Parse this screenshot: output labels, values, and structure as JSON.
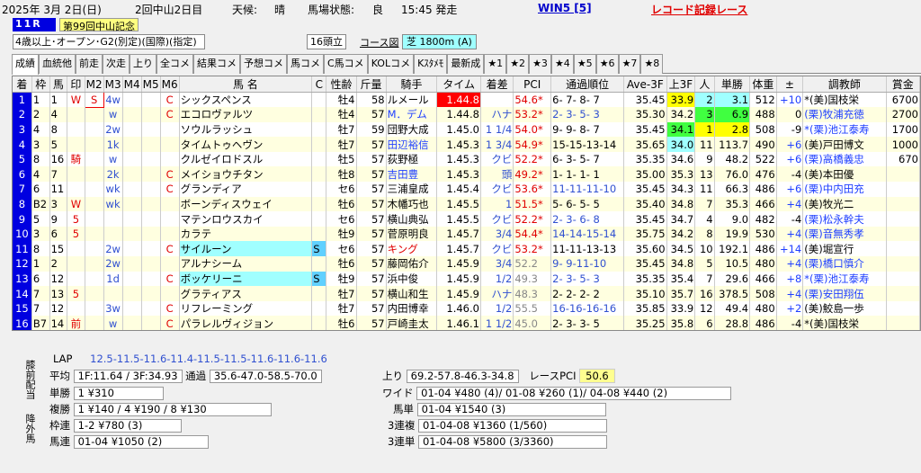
{
  "header": {
    "date": "2025年  3月  2日(日)",
    "meeting": "2回中山2日目",
    "weather_label": "天候:",
    "weather": "晴",
    "track_label": "馬場状態:",
    "track": "良",
    "time": "15:45 発走",
    "win5": "WIN5 [5]",
    "record": "レコード記録レース"
  },
  "race": {
    "num": "11R",
    "name": "第99回中山記念",
    "condition": "4歳以上･オープン･G2(別定)(国際)(指定)",
    "heads": "16頭立",
    "course_label": "コース図",
    "course": "芝 1800m (A)"
  },
  "tabs": [
    "成績",
    "血統他",
    "前走",
    "次走",
    "上り",
    "全コメ",
    "結果コメ",
    "予想コメ",
    "馬コメ",
    "C馬コメ",
    "KOLコメ",
    "Kｽﾀﾒﾓ",
    "最新成",
    "★1",
    "★2",
    "★3",
    "★4",
    "★5",
    "★6",
    "★7",
    "★8"
  ],
  "columns": [
    "着",
    "枠",
    "馬",
    "印",
    "M2",
    "M3",
    "M4",
    "M5",
    "M6",
    "馬 名",
    "C",
    "性齢",
    "斤量",
    "騎手",
    "タイム",
    "着差",
    "PCI",
    "通過順位",
    "Ave-3F",
    "上3F",
    "人",
    "単勝",
    "体重",
    "±",
    "調教師",
    "賞金"
  ],
  "rows": [
    [
      "1",
      "1",
      "1",
      "W",
      "S",
      "4w",
      "",
      "",
      "C",
      "シックスペンス",
      "",
      "牡4",
      "58",
      "ルメール",
      "1.44.8",
      "",
      "54.6*",
      "6- 7- 8- 7",
      "35.45",
      "33.9",
      "2",
      "3.1",
      "512",
      "+10",
      "*(美)国枝栄",
      "6700"
    ],
    [
      "2",
      "2",
      "4",
      "",
      "",
      "w",
      "",
      "",
      "C",
      "エコロヴァルツ",
      "",
      "牡4",
      "57",
      "M．デム",
      "1.44.8",
      "ハナ",
      "53.2*",
      "2- 3- 5- 3",
      "35.30",
      "34.2",
      "3",
      "6.9",
      "488",
      "0",
      "(栗)牧浦充徳",
      "2700"
    ],
    [
      "3",
      "4",
      "8",
      "",
      "",
      "2w",
      "",
      "",
      "",
      "ソウルラッシュ",
      "",
      "牡7",
      "59",
      "団野大成",
      "1.45.0",
      "1 1/4",
      "54.0*",
      "9- 9- 8- 7",
      "35.45",
      "34.1",
      "1",
      "2.8",
      "508",
      "-9",
      "*(栗)池江泰寿",
      "1700"
    ],
    [
      "4",
      "3",
      "5",
      "",
      "",
      "1k",
      "",
      "",
      "",
      "タイムトゥヘヴン",
      "",
      "牡7",
      "57",
      "田辺裕信",
      "1.45.3",
      "1 3/4",
      "54.9*",
      "15-15-13-14",
      "35.65",
      "34.0",
      "11",
      "113.7",
      "490",
      "+6",
      "(美)戸田博文",
      "1000"
    ],
    [
      "5",
      "8",
      "16",
      "騎",
      "",
      "w",
      "",
      "",
      "",
      "クルゼイロドスル",
      "",
      "牡5",
      "57",
      "荻野極",
      "1.45.3",
      "クビ",
      "52.2*",
      "6- 3- 5- 7",
      "35.35",
      "34.6",
      "9",
      "48.2",
      "522",
      "+6",
      "(栗)高橋義忠",
      "670"
    ],
    [
      "6",
      "4",
      "7",
      "",
      "",
      "2k",
      "",
      "",
      "C",
      "メイショウチタン",
      "",
      "牡8",
      "57",
      "吉田豊",
      "1.45.3",
      "頭",
      "49.2*",
      "1- 1- 1- 1",
      "35.00",
      "35.3",
      "13",
      "76.0",
      "476",
      "-4",
      "(美)本田優",
      ""
    ],
    [
      "7",
      "6",
      "11",
      "",
      "",
      "wk",
      "",
      "",
      "C",
      "グランディア",
      "",
      "セ6",
      "57",
      "三浦皇成",
      "1.45.4",
      "クビ",
      "53.6*",
      "11-11-11-10",
      "35.45",
      "34.3",
      "11",
      "66.3",
      "486",
      "+6",
      "(栗)中内田充",
      ""
    ],
    [
      "8",
      "B2",
      "3",
      "W",
      "",
      "wk",
      "",
      "",
      "",
      "ボーンディスウェイ",
      "",
      "牡6",
      "57",
      "木幡巧也",
      "1.45.5",
      "1",
      "51.5*",
      "5- 6- 5- 5",
      "35.40",
      "34.8",
      "7",
      "35.3",
      "466",
      "+4",
      "(美)牧光二",
      ""
    ],
    [
      "9",
      "5",
      "9",
      "5",
      "",
      "",
      "",
      "",
      "",
      "マテンロウスカイ",
      "",
      "セ6",
      "57",
      "横山典弘",
      "1.45.5",
      "クビ",
      "52.2*",
      "2- 3- 6- 8",
      "35.45",
      "34.7",
      "4",
      "9.0",
      "482",
      "-4",
      "(栗)松永幹夫",
      ""
    ],
    [
      "10",
      "3",
      "6",
      "5",
      "",
      "",
      "",
      "",
      "",
      "カラテ",
      "",
      "牡9",
      "57",
      "菅原明良",
      "1.45.7",
      "3/4",
      "54.4*",
      "14-14-15-14",
      "35.75",
      "34.2",
      "8",
      "19.9",
      "530",
      "+4",
      "(栗)音無秀孝",
      ""
    ],
    [
      "11",
      "8",
      "15",
      "",
      "",
      "2w",
      "",
      "",
      "C",
      "サイルーン",
      "S",
      "セ6",
      "57",
      "キング",
      "1.45.7",
      "クビ",
      "53.2*",
      "11-11-13-13",
      "35.60",
      "34.5",
      "10",
      "192.1",
      "486",
      "+14",
      "(美)堀宣行",
      ""
    ],
    [
      "12",
      "1",
      "2",
      "",
      "",
      "2w",
      "",
      "",
      "",
      "アルナシーム",
      "",
      "牡6",
      "57",
      "藤岡佑介",
      "1.45.9",
      "3/4",
      "52.2",
      "9- 9-11-10",
      "35.45",
      "34.8",
      "5",
      "10.5",
      "480",
      "+4",
      "(栗)橋口慎介",
      ""
    ],
    [
      "13",
      "6",
      "12",
      "",
      "",
      "1d",
      "",
      "",
      "C",
      "ボッケリーニ",
      "S",
      "牡9",
      "57",
      "浜中俊",
      "1.45.9",
      "1/2",
      "49.3",
      "2- 3- 5- 3",
      "35.35",
      "35.4",
      "7",
      "29.6",
      "466",
      "+8",
      "*(栗)池江泰寿",
      ""
    ],
    [
      "14",
      "7",
      "13",
      "5",
      "",
      "",
      "",
      "",
      "",
      "グラティアス",
      "",
      "牡7",
      "57",
      "横山和生",
      "1.45.9",
      "ハナ",
      "48.3",
      "2- 2- 2- 2",
      "35.10",
      "35.7",
      "16",
      "378.5",
      "508",
      "+4",
      "(栗)安田翔伍",
      ""
    ],
    [
      "15",
      "7",
      "12",
      "",
      "",
      "3w",
      "",
      "",
      "C",
      "リフレーミング",
      "",
      "牡7",
      "57",
      "内田博幸",
      "1.46.0",
      "1/2",
      "55.5",
      "16-16-16-16",
      "35.85",
      "33.9",
      "12",
      "49.4",
      "480",
      "+2",
      "(美)鮫島一歩",
      ""
    ],
    [
      "16",
      "B7",
      "14",
      "前",
      "",
      "w",
      "",
      "",
      "C",
      "パラレルヴィジョン",
      "",
      "牡6",
      "57",
      "戸崎圭太",
      "1.46.1",
      "1 1/2",
      "45.0",
      "2- 3- 3- 5",
      "35.25",
      "35.8",
      "6",
      "28.8",
      "486",
      "-4",
      "*(美)国枝栄",
      ""
    ]
  ],
  "bottom": {
    "side1": "膝前配当",
    "side2": "降外馬",
    "lap_label": "LAP",
    "lap": "12.5-11.5-11.6-11.4-11.5-11.5-11.6-11.6-11.6",
    "avg_label": "平均",
    "avg": "1F:11.64 / 3F:34.93",
    "pass_label": "通過",
    "pass": "35.6-47.0-58.5-70.0",
    "up_label": "上り",
    "up": "69.2-57.8-46.3-34.8",
    "pci_label": "レースPCI",
    "pci": "50.6",
    "tan_label": "単勝",
    "tan": "1 ¥310",
    "fuku_label": "複勝",
    "fuku": "1 ¥140 / 4 ¥190 / 8 ¥130",
    "waku_label": "枠連",
    "waku": "1-2 ¥780 (3)",
    "umaren_label": "馬連",
    "umaren": "01-04 ¥1050 (2)",
    "wide_label": "ワイド",
    "wide": "01-04 ¥480 (4)/ 01-08 ¥260 (1)/ 04-08 ¥440 (2)",
    "umatan_label": "馬単",
    "umatan": "01-04 ¥1540 (3)",
    "sanpuku_label": "3連複",
    "sanpuku": "01-04-08 ¥1360 (1/560)",
    "santan_label": "3連単",
    "santan": "01-04-08 ¥5800 (3/3360)"
  }
}
